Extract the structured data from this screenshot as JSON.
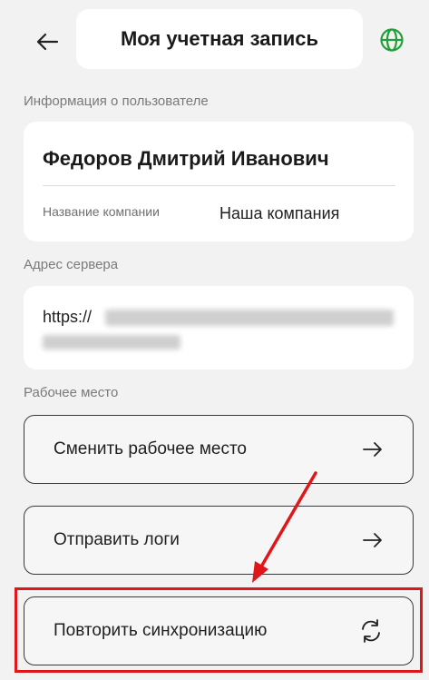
{
  "header": {
    "title": "Моя учетная запись"
  },
  "user_info": {
    "section_label": "Информация о пользователе",
    "full_name": "Федоров Дмитрий Иванович",
    "company_label": "Название компании",
    "company_value": "Наша компания"
  },
  "server": {
    "section_label": "Адрес сервера",
    "url_prefix": "https://"
  },
  "workplace": {
    "section_label": "Рабочее место",
    "buttons": [
      {
        "label": "Сменить рабочее место",
        "icon": "arrow-right-icon"
      },
      {
        "label": "Отправить логи",
        "icon": "arrow-right-icon"
      },
      {
        "label": "Повторить синхронизацию",
        "icon": "sync-icon"
      }
    ]
  },
  "colors": {
    "background": "#f2f2f2",
    "card": "#ffffff",
    "accent_green": "#21a038",
    "annotation_red": "#e0161b"
  }
}
